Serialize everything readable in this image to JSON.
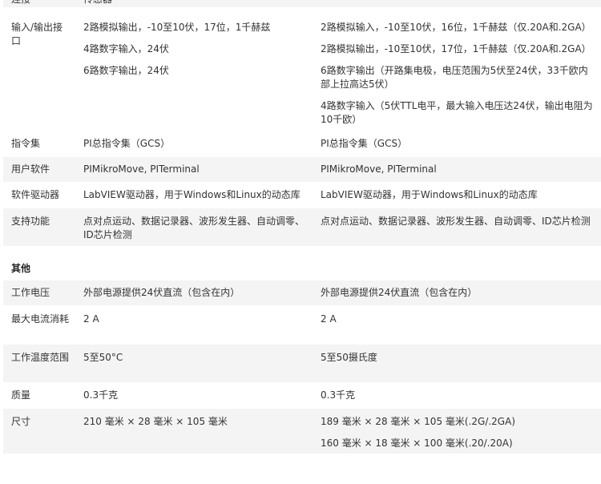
{
  "top_row": {
    "label": "连接",
    "c1": "传感器"
  },
  "rows": [
    {
      "label": "输入/输出接口",
      "c1": [
        "2路模拟输出，-10至10伏，17位，1千赫兹",
        "4路数字输入，24伏",
        "6路数字输出，24伏"
      ],
      "c2": [
        "2路模拟输入，-10至10伏，16位，1千赫兹（仅.20A和.2GA）",
        "2路模拟输出，-10至10伏，17位，1千赫兹（仅.20A和.2GA）",
        "6路数字输出（开路集电极，电压范围为5伏至24伏，33千欧内部上拉高达5伏）",
        "4路数字输入（5伏TTL电平，最大输入电压达24伏，输出电阻为10千欧）"
      ]
    },
    {
      "label": "指令集",
      "c1": [
        "PI总指令集（GCS）"
      ],
      "c2": [
        "PI总指令集（GCS）"
      ]
    },
    {
      "label": "用户软件",
      "c1": [
        "PIMikroMove, PITerminal"
      ],
      "c2": [
        "PIMikroMove, PITerminal"
      ]
    },
    {
      "label": "软件驱动器",
      "c1": [
        "LabVIEW驱动器，用于Windows和Linux的动态库"
      ],
      "c2": [
        "LabVIEW驱动器，用于Windows和Linux的动态库"
      ]
    },
    {
      "label": "支持功能",
      "c1": [
        "点对点运动、数据记录器、波形发生器、自动调零、ID芯片检测"
      ],
      "c2": [
        "点对点运动、数据记录器、波形发生器、自动调零、ID芯片检测"
      ]
    }
  ],
  "section_title": "其他",
  "other_rows": [
    {
      "label": "工作电压",
      "c1": [
        "外部电源提供24伏直流（包含在内）"
      ],
      "c2": [
        "外部电源提供24伏直流（包含在内）"
      ]
    },
    {
      "label": "最大电流消耗",
      "c1": [
        "2 A"
      ],
      "c2": [
        "2 A"
      ]
    },
    {
      "label": "工作温度范围",
      "c1": [
        "5至50°C"
      ],
      "c2": [
        "5至50摄氏度"
      ]
    },
    {
      "label": "质量",
      "c1": [
        "0.3千克"
      ],
      "c2": [
        "0.3千克"
      ]
    },
    {
      "label": "尺寸",
      "c1": [
        "210 毫米 × 28 毫米 × 105 毫米"
      ],
      "c2": [
        "189 毫米 × 28 毫米 × 105 毫米(.2G/.2GA)",
        "160 毫米 × 18 毫米 × 100 毫米(.20/.20A)"
      ]
    }
  ]
}
